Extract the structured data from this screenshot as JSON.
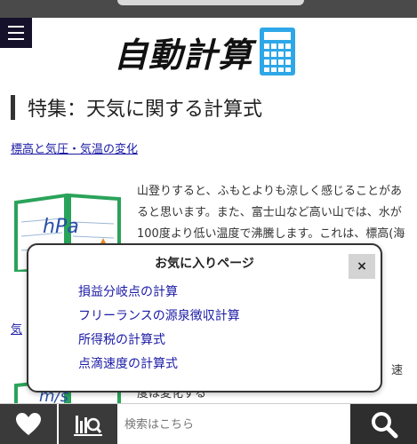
{
  "header": {
    "logo_text": "自動計算",
    "menu_icon": "hamburger-menu-icon",
    "logo_icon": "calculator-icon"
  },
  "feature": {
    "title": "特集：天気に関する計算式"
  },
  "articles": [
    {
      "link": "標高と気圧・気温の変化",
      "thumb_label": "hPa",
      "text": "山登りすると、ふもとよりも涼しく感じることがあると思います。また、富士山など高い山では、水が100度より低い温度で沸騰します。これは、標高(海水面からの高からで"
    },
    {
      "link": "気",
      "thumb_label": "m/s",
      "text": "度は変化する",
      "side": "速"
    }
  ],
  "favorites": {
    "title": "お気に入りページ",
    "close_label": "×",
    "items": [
      "損益分岐点の計算",
      "フリーランスの源泉徴収計算",
      "所得税の計算式",
      "点滴速度の計算式"
    ]
  },
  "bottom_bar": {
    "search_placeholder": "検索はこちら",
    "favorites_icon": "heart-icon",
    "history_icon": "history-icon",
    "search_icon": "search-icon"
  },
  "colors": {
    "link": "#1a1aa6",
    "calculator_blue": "#2ea7e8",
    "bar_dark": "#3a3a3a"
  }
}
